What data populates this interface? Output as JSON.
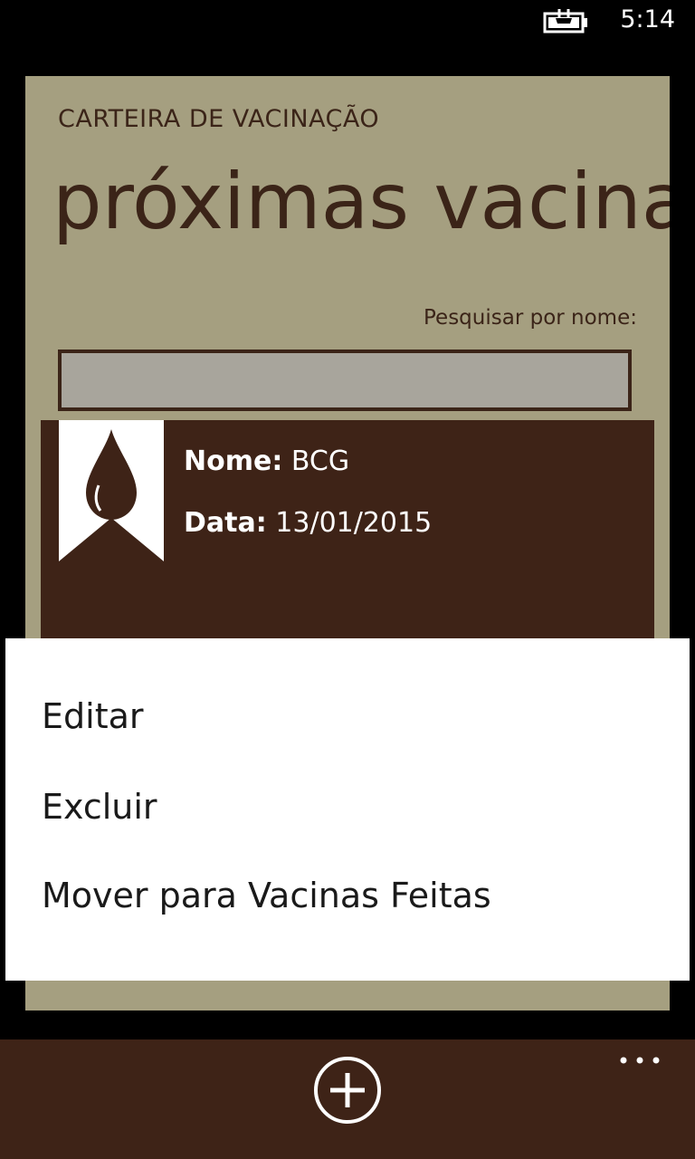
{
  "status_bar": {
    "time": "5:14",
    "battery_icon": "battery-charging-icon"
  },
  "header": {
    "app_title": "CARTEIRA DE VACINAÇÃO",
    "page_title": "próximas vacinas"
  },
  "search": {
    "label": "Pesquisar por nome:",
    "value": "",
    "placeholder": ""
  },
  "vaccines": [
    {
      "icon": "blood-drop-ribbon-icon",
      "name_label": "Nome:",
      "name": "BCG",
      "date_label": "Data:",
      "date": "13/01/2015"
    }
  ],
  "context_menu": {
    "items": [
      {
        "label": "Editar"
      },
      {
        "label": "Excluir"
      },
      {
        "label": "Mover para Vacinas Feitas"
      }
    ]
  },
  "app_bar": {
    "add_icon": "add-circle-icon",
    "more_icon": "ellipsis-icon"
  },
  "colors": {
    "page_background": "#a59f80",
    "brown_accent": "#3e2317",
    "text_dark": "#3b2418",
    "menu_background": "#ffffff"
  }
}
